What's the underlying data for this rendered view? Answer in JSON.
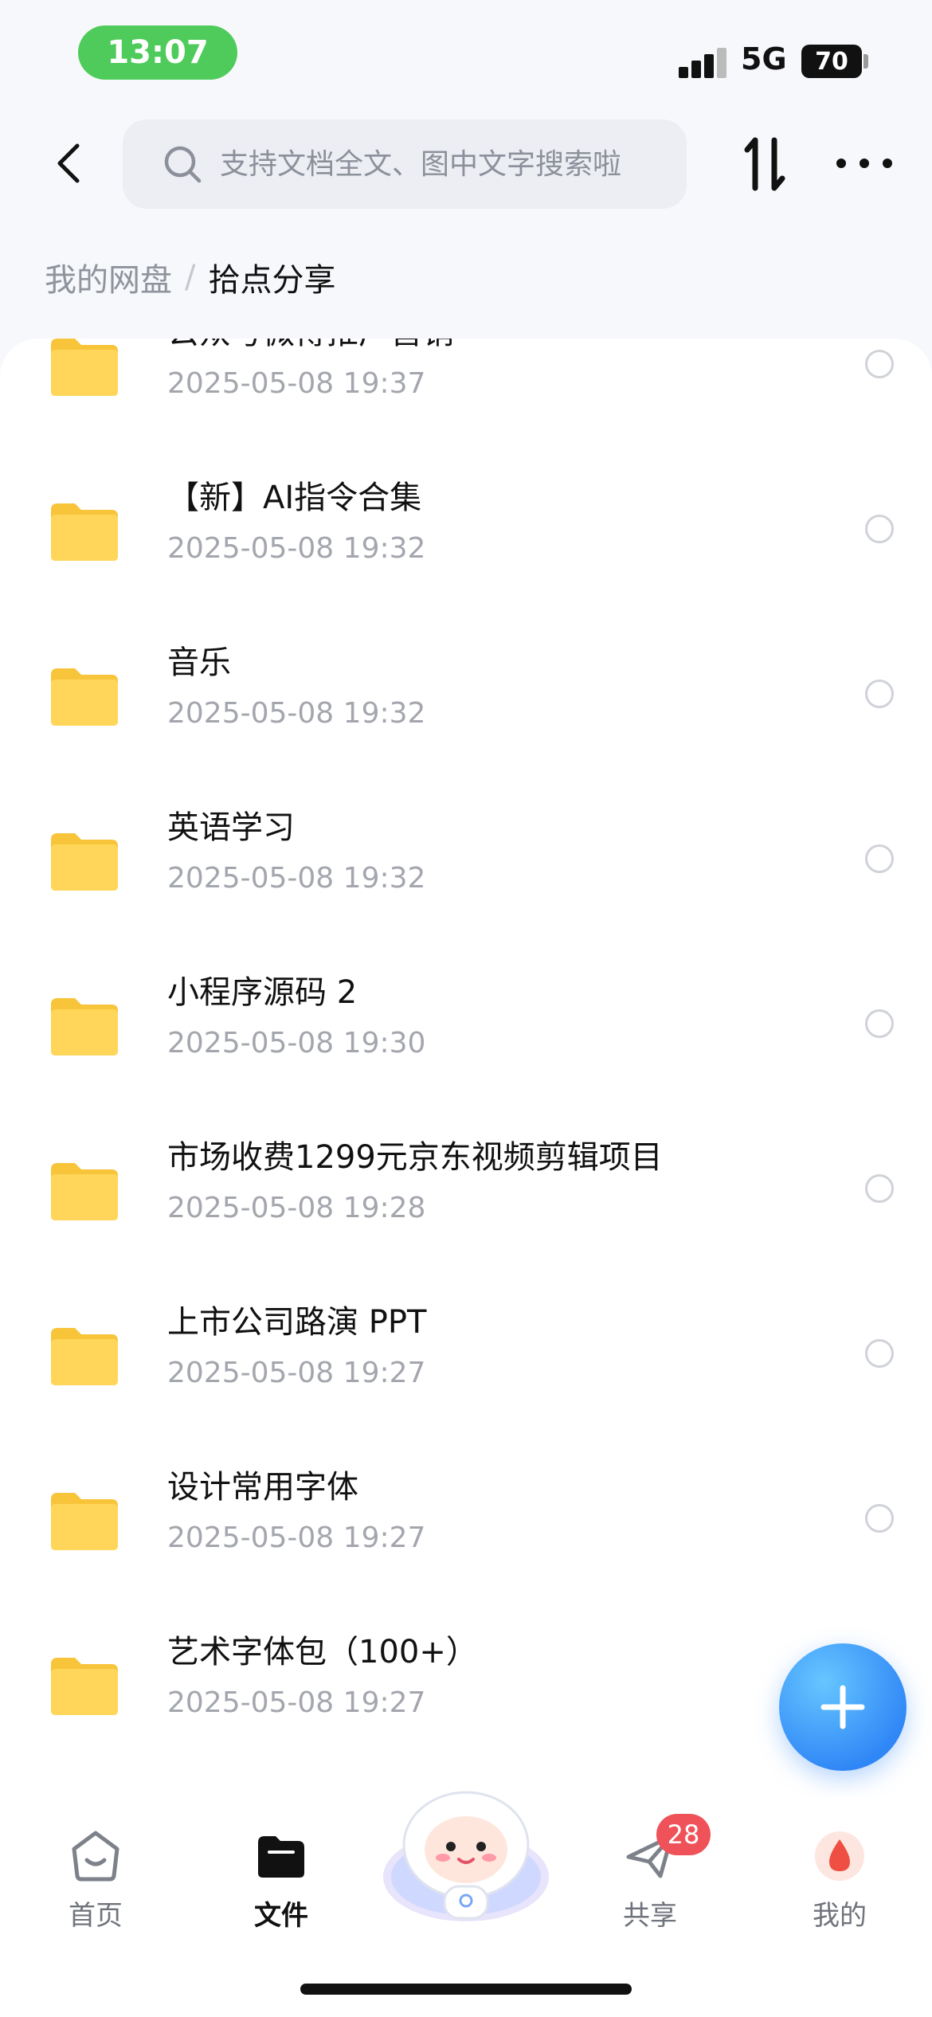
{
  "status_bar": {
    "time": "13:07",
    "network": "5G",
    "battery": "70"
  },
  "header": {
    "search_placeholder": "支持文档全文、图中文字搜索啦"
  },
  "breadcrumb": {
    "root": "我的网盘",
    "separator": "/",
    "current": "拾点分享"
  },
  "files": [
    {
      "name": "公众号微博推广营销",
      "date": "2025-05-08 19:37",
      "icon": "folder-icon"
    },
    {
      "name": "【新】AI指令合集",
      "date": "2025-05-08 19:32",
      "icon": "folder-icon"
    },
    {
      "name": "音乐",
      "date": "2025-05-08 19:32",
      "icon": "folder-icon"
    },
    {
      "name": "英语学习",
      "date": "2025-05-08 19:32",
      "icon": "folder-icon"
    },
    {
      "name": "小程序源码 2",
      "date": "2025-05-08 19:30",
      "icon": "folder-icon"
    },
    {
      "name": "市场收费1299元京东视频剪辑项目",
      "date": "2025-05-08 19:28",
      "icon": "folder-icon"
    },
    {
      "name": "上市公司路演 PPT",
      "date": "2025-05-08 19:27",
      "icon": "folder-icon"
    },
    {
      "name": "设计常用字体",
      "date": "2025-05-08 19:27",
      "icon": "folder-icon"
    },
    {
      "name": "艺术字体包（100+）",
      "date": "2025-05-08 19:27",
      "icon": "folder-icon"
    }
  ],
  "bottom_nav": {
    "home": "首页",
    "files": "文件",
    "share": "共享",
    "share_badge": "28",
    "me": "我的"
  },
  "colors": {
    "accent": "#2f86f6",
    "folder": "#ffd24a",
    "badge": "#f0525a",
    "status_pill": "#4fcb5b"
  }
}
